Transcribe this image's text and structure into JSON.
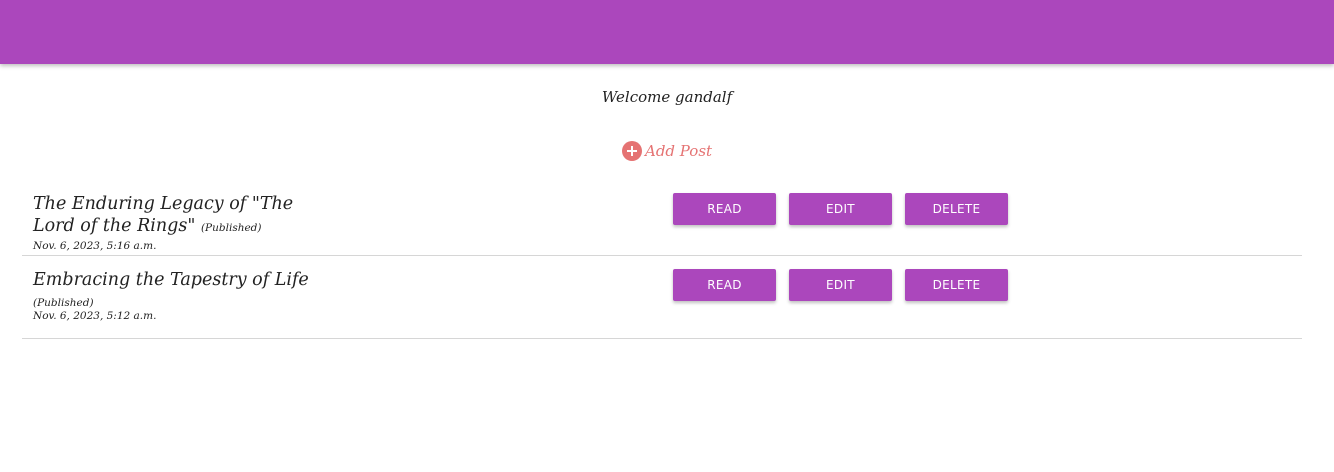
{
  "header": {
    "color": "#ab47bc"
  },
  "welcome_text": "Welcome gandalf",
  "add_post": {
    "label": "Add Post",
    "icon": "plus-circle-icon",
    "color": "#e57373"
  },
  "posts": [
    {
      "title": "The Enduring Legacy of \"The Lord of the Rings\"",
      "status": "(Published)",
      "date": "Nov. 6, 2023, 5:16 a.m.",
      "actions": {
        "read": "READ",
        "edit": "EDIT",
        "delete": "DELETE"
      }
    },
    {
      "title": "Embracing the Tapestry of Life",
      "status": "(Published)",
      "date": "Nov. 6, 2023, 5:12 a.m.",
      "actions": {
        "read": "READ",
        "edit": "EDIT",
        "delete": "DELETE"
      }
    }
  ]
}
